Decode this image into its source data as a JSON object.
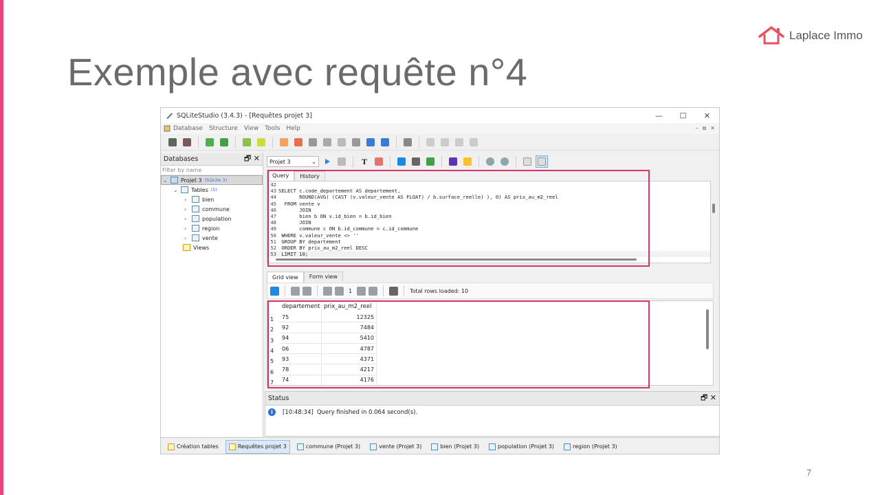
{
  "slide": {
    "title": "Exemple avec requête n°4",
    "logo_text": "Laplace Immo",
    "page_number": "7",
    "accent_color": "#e8457a"
  },
  "window": {
    "title": "SQLiteStudio (3.4.3) - [Requêtes projet 3]",
    "controls": [
      "—",
      "☐",
      "✕"
    ],
    "menu": [
      "Database",
      "Structure",
      "View",
      "Tools",
      "Help"
    ],
    "mdi_controls": [
      "–",
      "⧉",
      "✕"
    ]
  },
  "databases_panel": {
    "title": "Databases",
    "filter_placeholder": "Filter by name",
    "db_name": "Projet 3",
    "db_type": "(SQLite 3)",
    "tables_label": "Tables",
    "tables_count": "(5)",
    "tables": [
      "bien",
      "commune",
      "population",
      "region",
      "vente"
    ],
    "views_label": "Views"
  },
  "editor": {
    "db_selected": "Projet 3",
    "tabs": [
      "Query",
      "History"
    ],
    "lines": [
      {
        "n": "42",
        "code": ""
      },
      {
        "n": "43",
        "code": "SELECT c.code_departement AS departement,"
      },
      {
        "n": "44",
        "code": "       ROUND(AVG( (CAST (v.valeur_vente AS FLOAT) / b.surface_reelle) ), 0) AS prix_au_m2_reel"
      },
      {
        "n": "45",
        "code": "  FROM vente v"
      },
      {
        "n": "46",
        "code": "       JOIN"
      },
      {
        "n": "47",
        "code": "       bien b ON v.id_bien = b.id_bien"
      },
      {
        "n": "48",
        "code": "       JOIN"
      },
      {
        "n": "49",
        "code": "       commune c ON b.id_commune = c.id_commune"
      },
      {
        "n": "50",
        "code": " WHERE v.valeur_vente <> ''"
      },
      {
        "n": "51",
        "code": " GROUP BY departement"
      },
      {
        "n": "52",
        "code": " ORDER BY prix_au_m2_reel DESC"
      },
      {
        "n": "53",
        "code": " LIMIT 10;"
      }
    ]
  },
  "results": {
    "tabs": [
      "Grid view",
      "Form view"
    ],
    "page": "1",
    "total_rows": "Total rows loaded: 10",
    "columns": [
      "departement",
      "prix_au_m2_reel"
    ],
    "rows": [
      {
        "n": "1",
        "dep": "75",
        "prix": "12325"
      },
      {
        "n": "2",
        "dep": "92",
        "prix": "7484"
      },
      {
        "n": "3",
        "dep": "94",
        "prix": "5410"
      },
      {
        "n": "4",
        "dep": "06",
        "prix": "4787"
      },
      {
        "n": "5",
        "dep": "93",
        "prix": "4371"
      },
      {
        "n": "6",
        "dep": "78",
        "prix": "4217"
      },
      {
        "n": "7",
        "dep": "74",
        "prix": "4176"
      }
    ]
  },
  "status": {
    "title": "Status",
    "message_time": "[10:48:34]",
    "message": "Query finished in 0.064 second(s)."
  },
  "taskbar": [
    "Création tables",
    "Requêtes projet 3",
    "commune (Projet 3)",
    "vente (Projet 3)",
    "bien (Projet 3)",
    "population (Projet 3)",
    "region (Projet 3)"
  ]
}
